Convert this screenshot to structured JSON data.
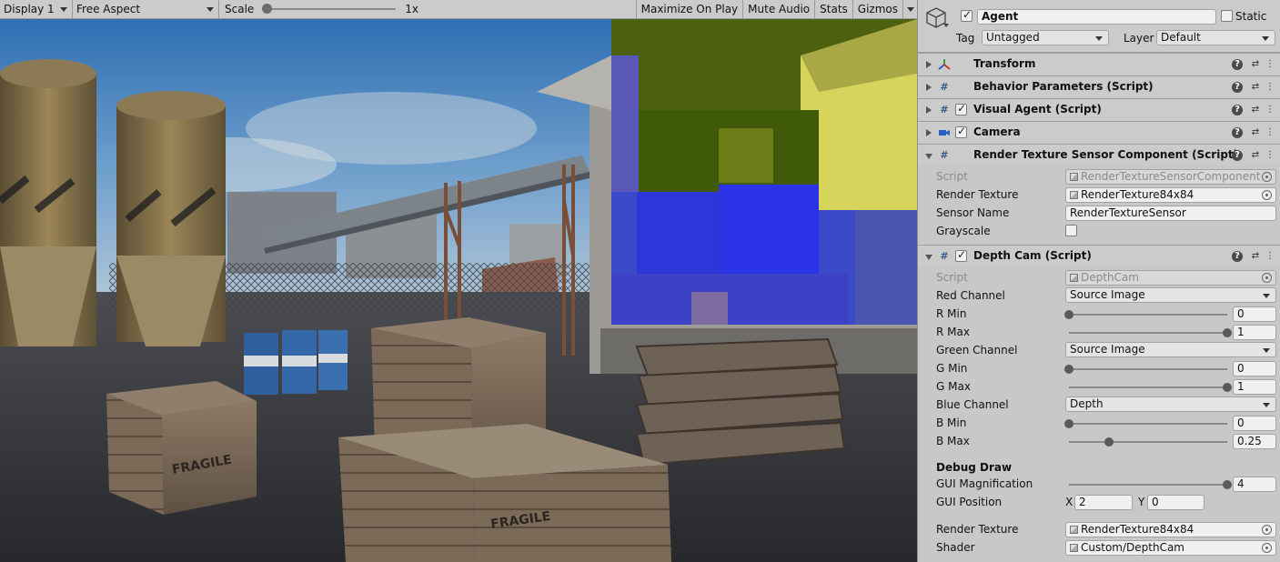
{
  "toolbar": {
    "display": "Display 1",
    "aspect": "Free Aspect",
    "scale_label": "Scale",
    "scale_value": "1x",
    "maximize": "Maximize On Play",
    "mute": "Mute Audio",
    "stats": "Stats",
    "gizmos": "Gizmos"
  },
  "scene": {
    "crate_stencil": "FRAGILE"
  },
  "inspector": {
    "object_name": "Agent",
    "static_label": "Static",
    "tag_label": "Tag",
    "tag_value": "Untagged",
    "layer_label": "Layer",
    "layer_value": "Default",
    "components": [
      {
        "title": "Transform",
        "icon": "transform-icon"
      },
      {
        "title": "Behavior Parameters (Script)",
        "icon": "script-icon"
      },
      {
        "title": "Visual Agent (Script)",
        "icon": "script-icon"
      },
      {
        "title": "Camera",
        "icon": "camera-icon"
      },
      {
        "title": "Render Texture Sensor Component (Script)",
        "icon": "script-icon"
      },
      {
        "title": "Depth Cam (Script)",
        "icon": "script-icon"
      }
    ],
    "rts": {
      "script_label": "Script",
      "script_value": "RenderTextureSensorComponent",
      "render_texture_label": "Render Texture",
      "render_texture_value": "RenderTexture84x84",
      "sensor_name_label": "Sensor Name",
      "sensor_name_value": "RenderTextureSensor",
      "grayscale_label": "Grayscale"
    },
    "depth": {
      "script_label": "Script",
      "script_value": "DepthCam",
      "red_channel_label": "Red Channel",
      "red_channel_value": "Source Image",
      "r_min_label": "R Min",
      "r_min_value": "0",
      "r_max_label": "R Max",
      "r_max_value": "1",
      "green_channel_label": "Green Channel",
      "green_channel_value": "Source Image",
      "g_min_label": "G Min",
      "g_min_value": "0",
      "g_max_label": "G Max",
      "g_max_value": "1",
      "blue_channel_label": "Blue Channel",
      "blue_channel_value": "Depth",
      "b_min_label": "B Min",
      "b_min_value": "0",
      "b_max_label": "B Max",
      "b_max_value": "0.25",
      "debug_draw_label": "Debug Draw",
      "gui_mag_label": "GUI Magnification",
      "gui_mag_value": "4",
      "gui_pos_label": "GUI Position",
      "gui_pos_x_label": "X",
      "gui_pos_x_value": "2",
      "gui_pos_y_label": "Y",
      "gui_pos_y_value": "0",
      "render_texture_label": "Render Texture",
      "render_texture_value": "RenderTexture84x84",
      "shader_label": "Shader",
      "shader_value": "Custom/DepthCam"
    },
    "sliders": {
      "r_min": 0,
      "r_max": 1,
      "g_min": 0,
      "g_max": 1,
      "b_min": 0,
      "b_max": 0.25,
      "gui_mag": 1.0
    }
  }
}
